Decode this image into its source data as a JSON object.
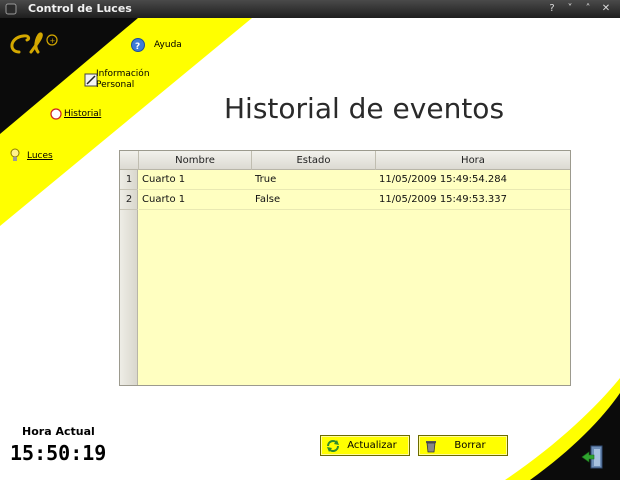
{
  "window": {
    "title": "Control de Luces"
  },
  "sidebar": {
    "items": [
      {
        "label": "Ayuda",
        "icon": "help-icon"
      },
      {
        "label": "Información Personal",
        "line1": "Información",
        "line2": "Personal",
        "icon": "edit-icon"
      },
      {
        "label": "Historial",
        "icon": "history-icon"
      },
      {
        "label": "Luces",
        "icon": "bulb-icon"
      }
    ]
  },
  "main": {
    "title": "Historial de eventos",
    "table": {
      "columns": [
        "Nombre",
        "Estado",
        "Hora"
      ],
      "rows": [
        {
          "num": "1",
          "nombre": "Cuarto 1",
          "estado": "True",
          "hora": "11/05/2009 15:49:54.284"
        },
        {
          "num": "2",
          "nombre": "Cuarto 1",
          "estado": "False",
          "hora": "11/05/2009 15:49:53.337"
        }
      ]
    }
  },
  "clock": {
    "label": "Hora Actual",
    "time": "15:50:19"
  },
  "buttons": {
    "refresh": "Actualizar",
    "delete": "Borrar"
  },
  "colors": {
    "accent_yellow": "#ffff00",
    "table_bg": "#ffffc1",
    "dark": "#0b0b0b"
  }
}
